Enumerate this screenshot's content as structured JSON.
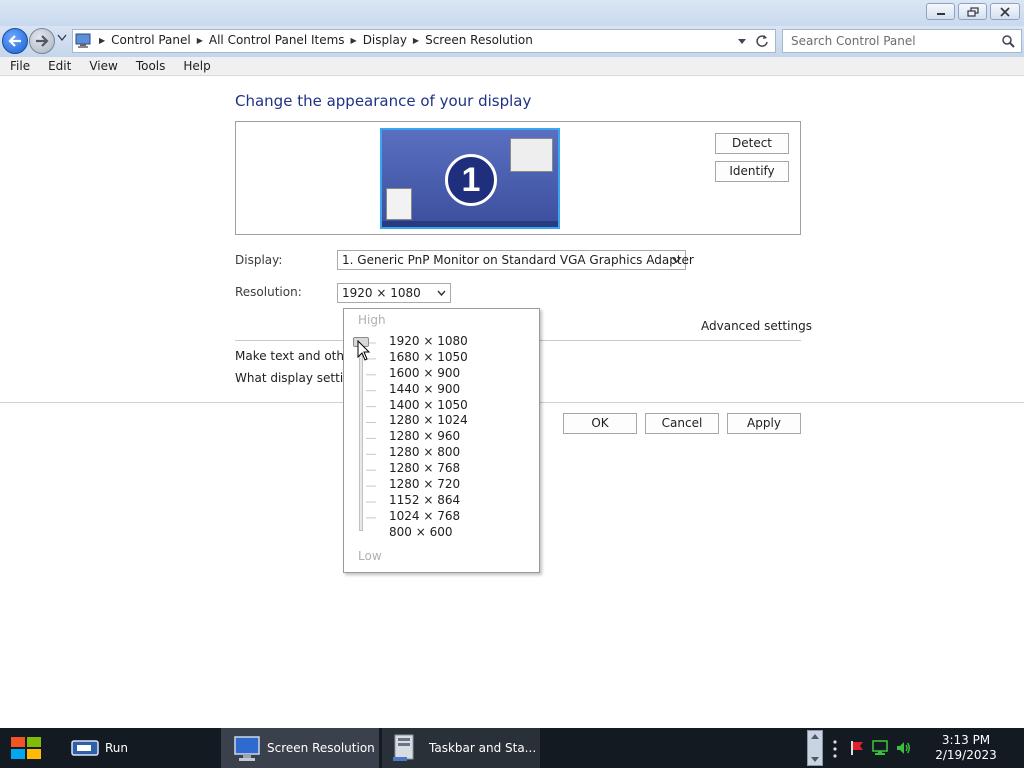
{
  "window": {
    "title_buttons": [
      "minimize",
      "restore",
      "close"
    ]
  },
  "address_bar": {
    "breadcrumbs": [
      "Control Panel",
      "All Control Panel Items",
      "Display",
      "Screen Resolution"
    ],
    "search_placeholder": "Search Control Panel"
  },
  "menu": [
    "File",
    "Edit",
    "View",
    "Tools",
    "Help"
  ],
  "page": {
    "heading": "Change the appearance of your display",
    "monitor_number": "1",
    "detect_label": "Detect",
    "identify_label": "Identify",
    "display_label": "Display:",
    "display_value": "1. Generic PnP Monitor on Standard VGA Graphics Adapter",
    "resolution_label": "Resolution:",
    "resolution_value": "1920 × 1080",
    "advanced_settings": "Advanced settings",
    "link_text_size": "Make text and othe",
    "link_display_settings": "What display settin",
    "ok_label": "OK",
    "cancel_label": "Cancel",
    "apply_label": "Apply"
  },
  "resolution_dropdown": {
    "high_label": "High",
    "low_label": "Low",
    "options": [
      "1920 × 1080",
      "1680 × 1050",
      "1600 × 900",
      "1440 × 900",
      "1400 × 1050",
      "1280 × 1024",
      "1280 × 960",
      "1280 × 800",
      "1280 × 768",
      "1280 × 720",
      "1152 × 864",
      "1024 × 768",
      "800 × 600"
    ],
    "selected_index": 0
  },
  "taskbar": {
    "items": [
      {
        "label": "Run",
        "icon": "run-icon"
      },
      {
        "label": "Screen Resolution",
        "icon": "screen-resolution-icon"
      },
      {
        "label": "Taskbar and Sta...",
        "icon": "taskbar-properties-icon"
      }
    ],
    "time": "3:13 PM",
    "date": "2/19/2023"
  },
  "colors": {
    "heading": "#1e3287",
    "taskbar": "#141a22",
    "address_bar": "#c5d6ec"
  }
}
